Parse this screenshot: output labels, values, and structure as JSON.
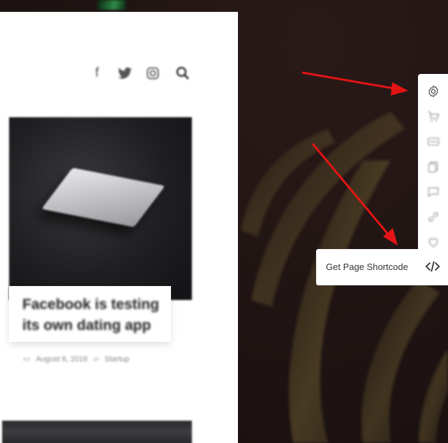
{
  "background": {
    "colors": {
      "dark": "#1d1312",
      "arrow": "#e41414"
    }
  },
  "left_preview": {
    "social_icons": [
      "facebook-icon",
      "twitter-icon",
      "instagram-icon",
      "search-icon"
    ],
    "post": {
      "title": "Facebook is testing its own dating app",
      "date": "August 6, 2018",
      "category": "Startup"
    }
  },
  "toolbar": {
    "tools": [
      {
        "name": "settings-gear-icon",
        "faded": false
      },
      {
        "name": "cart-icon",
        "faded": true
      },
      {
        "name": "card-icon",
        "faded": true
      },
      {
        "name": "copy-icon",
        "faded": true
      },
      {
        "name": "comment-icon",
        "faded": true
      },
      {
        "name": "link-icon",
        "faded": true
      },
      {
        "name": "heart-icon",
        "faded": true
      }
    ],
    "tooltip": {
      "label": "Get Page Shortcode",
      "icon": "code-icon"
    }
  }
}
